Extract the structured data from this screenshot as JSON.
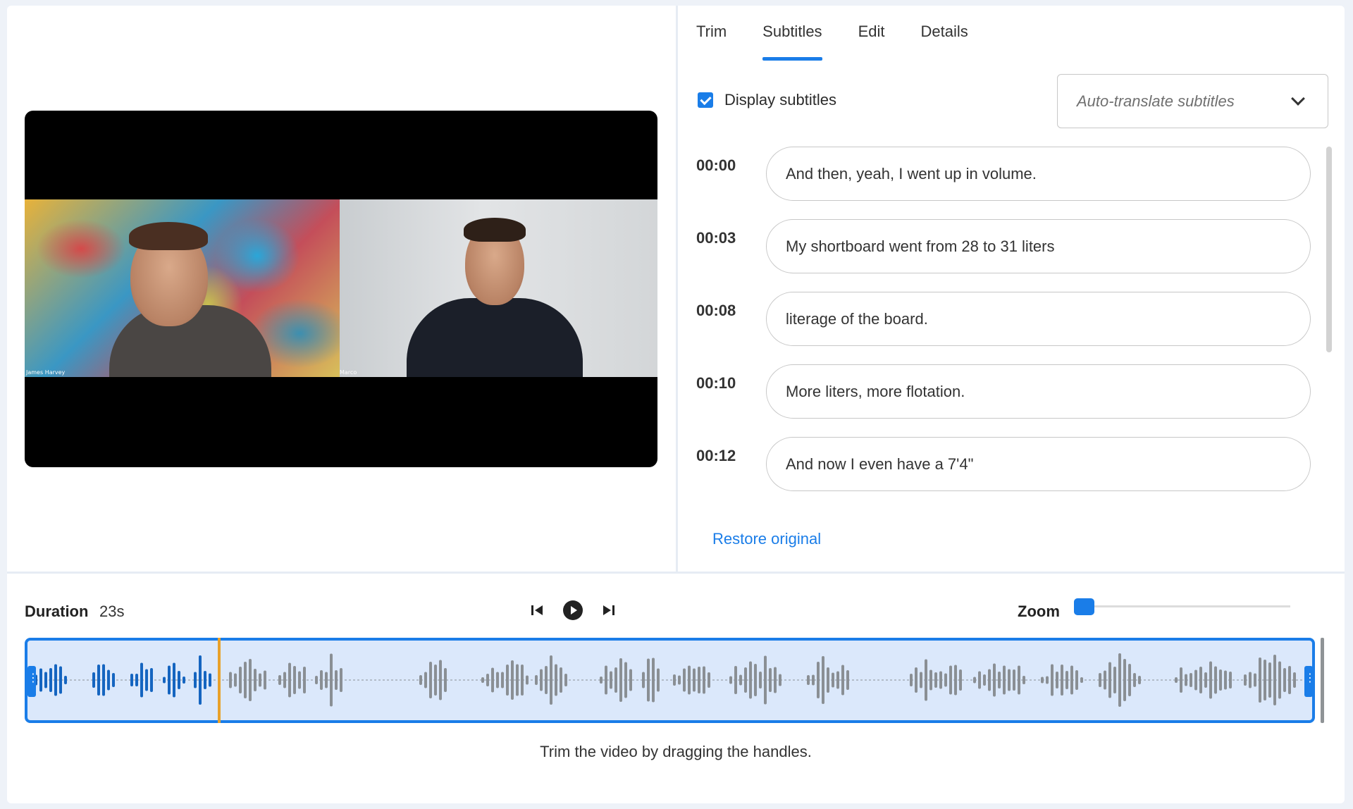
{
  "tabs": [
    {
      "label": "Trim",
      "active": false
    },
    {
      "label": "Subtitles",
      "active": true
    },
    {
      "label": "Edit",
      "active": false
    },
    {
      "label": "Details",
      "active": false
    }
  ],
  "video": {
    "participants": [
      {
        "name": "James Harvey"
      },
      {
        "name": "Marco"
      }
    ]
  },
  "subtitles": {
    "display_label": "Display subtitles",
    "display_checked": true,
    "translate_placeholder": "Auto-translate subtitles",
    "items": [
      {
        "time": "00:00",
        "text": "And then, yeah, I went up in volume."
      },
      {
        "time": "00:03",
        "text": "My shortboard went from 28 to 31 liters"
      },
      {
        "time": "00:08",
        "text": "literage of the board."
      },
      {
        "time": "00:10",
        "text": "More liters, more flotation."
      },
      {
        "time": "00:12",
        "text": "And now I even have a 7'4\""
      }
    ],
    "restore_label": "Restore original"
  },
  "timeline": {
    "duration_label": "Duration",
    "duration_value": "23s",
    "zoom_label": "Zoom",
    "zoom_level": 0.0,
    "hint": "Trim the video by dragging the handles."
  },
  "colors": {
    "accent": "#1a7de8",
    "playhead": "#e8a12a",
    "wave_played": "#1565c0",
    "wave_unplayed": "#8a8f94",
    "selection_fill": "#dbe8fb"
  }
}
